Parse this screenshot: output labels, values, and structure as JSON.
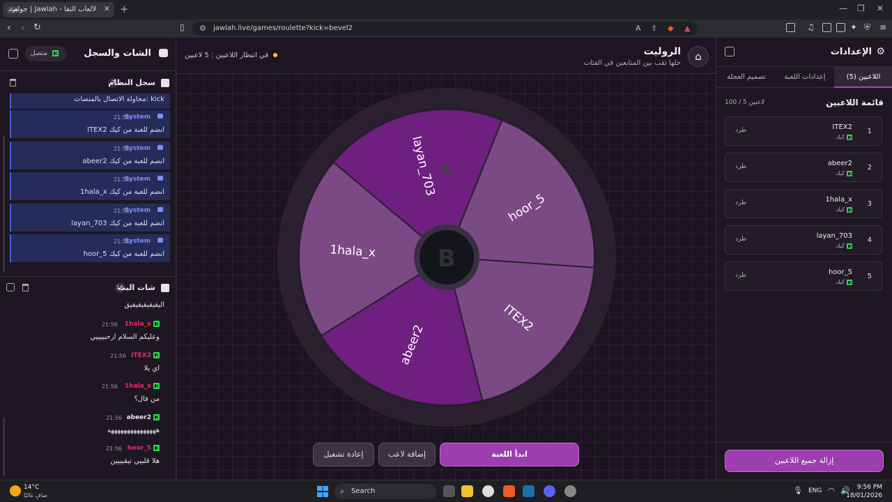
{
  "browser": {
    "tab_title": "جولة | Jawlah - منصة الألعاب التفا",
    "tab_favicon_text": "جولة",
    "url": "jawlah.live/games/roulette?kick=bevel2",
    "new_tab_symbol": "+",
    "icons": [
      "back-icon",
      "forward-icon",
      "reload-icon",
      "bookmark-icon",
      "translate-icon",
      "share-icon",
      "brave-shield-icon",
      "brave-rewards-icon",
      "sidebar-icon",
      "music-icon",
      "wallet-icon",
      "vpn-icon",
      "menu-icon"
    ]
  },
  "left_panel": {
    "title": "الشات والسجل",
    "status_label": "متصل",
    "system_log": {
      "title": "سجل النظام",
      "count": "7",
      "partial_message": "محاولة الاتصال بالمنصات: kick",
      "messages": [
        {
          "sender": "System",
          "time": "21:55",
          "text": "ITEX2 انضم للعبة من كيك"
        },
        {
          "sender": "System",
          "time": "21:55",
          "text": "abeer2 انضم للعبة من كيك"
        },
        {
          "sender": "System",
          "time": "21:55",
          "text": "1hala_x انضم للعبة من كيك"
        },
        {
          "sender": "System",
          "time": "21:55",
          "text": "layan_703 انضم للعبة من كيك"
        },
        {
          "sender": "System",
          "time": "21:55",
          "text": "hoor_5 انضم للعبة من كيك"
        }
      ]
    },
    "live_chat": {
      "title": "شات البث",
      "count": "16",
      "partial_message": "اليقيقيقيقيقيق",
      "messages": [
        {
          "user": "1hala_x",
          "time": "21:56",
          "text": "وعليكم السلام ارحبييييي",
          "color": "#e0306a"
        },
        {
          "user": "ITEX2",
          "time": "21:56",
          "text": "اي يلا",
          "color": "#e0306a"
        },
        {
          "user": "1hala_x",
          "time": "21:56",
          "text": "من فال؟",
          "color": "#e0306a"
        },
        {
          "user": "abeer2",
          "time": "21:56",
          "text": "هههههههههههههههه",
          "color": "#e8e2ee"
        },
        {
          "user": "hoor_5",
          "time": "21:56",
          "text": "هلا قلبيي تيقيييين",
          "color": "#e0306a"
        }
      ]
    }
  },
  "game": {
    "title": "الروليت",
    "subtitle": "خلها تقب بين المتابعين في الفئات",
    "status_players": "5 لاعبين",
    "status_waiting": "في انتظار اللاعبين",
    "start_button": "ابدأ اللعبة",
    "add_player_button": "إضافة لاعب",
    "reset_button": "إعادة تشغيل",
    "wheel_segments": [
      {
        "label": "hoor_5",
        "color": "#7b4a84"
      },
      {
        "label": "ITEX2",
        "color": "#7b4a84"
      },
      {
        "label": "abeer2",
        "color": "#6e1f80"
      },
      {
        "label": "1hala_x",
        "color": "#7b4a84"
      },
      {
        "label": "layan_703",
        "color": "#6e1f80"
      }
    ],
    "wheel_center_logo": "B"
  },
  "settings": {
    "title": "الإعدادات",
    "tabs": [
      "اللاعبين (5)",
      "إعدادات اللعبة",
      "تصميم العجلة"
    ],
    "players_heading": "قائمة اللاعبين",
    "players_count": "100 / 5 لاعبين",
    "kick_label": "طرد",
    "source_label": "كيك",
    "players": [
      {
        "rank": "1",
        "name": "ITEX2"
      },
      {
        "rank": "2",
        "name": "abeer2"
      },
      {
        "rank": "3",
        "name": "1hala_x"
      },
      {
        "rank": "4",
        "name": "layan_703"
      },
      {
        "rank": "5",
        "name": "hoor_5"
      }
    ],
    "remove_all_button": "إزالة جميع اللاعبين"
  },
  "taskbar": {
    "weather_temp": "14°C",
    "weather_condition": "صافٍ غالبًا",
    "search_label": "Search",
    "language": "ENG",
    "time": "9:56 PM",
    "date": "18/01/2026"
  },
  "colors": {
    "accent": "#9c3db0",
    "kick_green": "#2bd94b",
    "system_blue": "#7d8ef5"
  }
}
